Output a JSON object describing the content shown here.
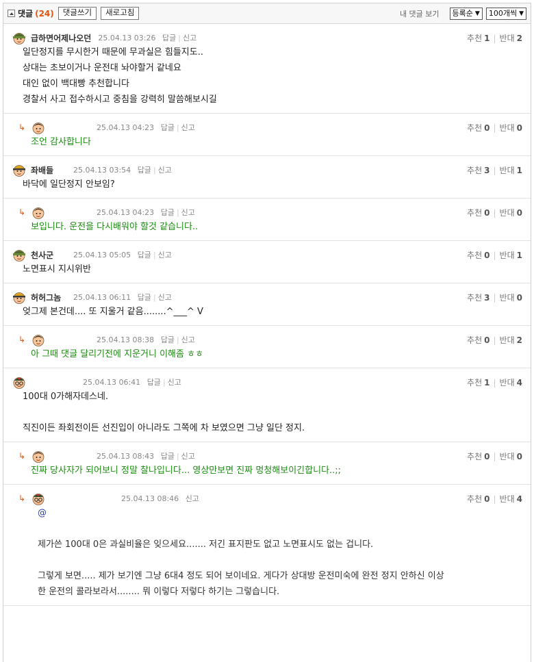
{
  "header": {
    "title": "댓글",
    "count": "(24)",
    "write_button": "댓글쓰기",
    "refresh_button": "새로고침",
    "my_comments": "내 댓글 보기",
    "sort_select": "등록순",
    "per_page_select": "100개씩"
  },
  "labels": {
    "reply": "답글",
    "report": "신고",
    "up": "추천",
    "down": "반대"
  },
  "colors": {
    "accent": "#e2540f",
    "reply_text": "#1e8c14",
    "mention": "#2a3aa0"
  },
  "comments": [
    {
      "type": "comment",
      "avatar": "green-helmet-avatar-icon",
      "nick": "급하면어제나오던",
      "date": "25.04.13 03:26",
      "up": "1",
      "down": "2",
      "lines": [
        "일단정지를 무시한거 때문에 무과실은 힘들지도..",
        "상대는 초보이거나 운전대 놔야할거 같네요",
        "대인 없이 백대빵 추천합니다",
        "경찰서 사고 접수하시고 중침을 강력히 말씀해보시길"
      ]
    },
    {
      "type": "reply",
      "avatar": "boy-avatar-icon",
      "nick": "",
      "date": "25.04.13 04:23",
      "up": "0",
      "down": "0",
      "lines": [
        "조언 감사합니다"
      ]
    },
    {
      "type": "comment",
      "avatar": "hardhat-avatar-icon",
      "nick": "좌배들",
      "date": "25.04.13 03:54",
      "up": "3",
      "down": "1",
      "lines": [
        "바닥에 일단정지 안보임?"
      ]
    },
    {
      "type": "reply",
      "avatar": "boy-avatar-icon",
      "nick": "",
      "date": "25.04.13 04:23",
      "up": "0",
      "down": "0",
      "lines": [
        "보입니다. 운전을 다시배워야 할것 같습니다.."
      ]
    },
    {
      "type": "comment",
      "avatar": "soldier-avatar-icon",
      "nick": "천사군",
      "date": "25.04.13 05:05",
      "up": "0",
      "down": "1",
      "lines": [
        "노면표시 지시위반"
      ]
    },
    {
      "type": "comment",
      "avatar": "hardhat-avatar-icon",
      "nick": "허허그놈",
      "date": "25.04.13 06:11",
      "up": "3",
      "down": "0",
      "lines": [
        "엊그제 본건데.... 또 지울거 같음........^___^ V"
      ]
    },
    {
      "type": "reply",
      "avatar": "boy-avatar-icon",
      "nick": "",
      "date": "25.04.13 08:38",
      "up": "0",
      "down": "2",
      "lines": [
        "아 그때 댓글 달리기전에 지운거니 이해좀 ㅎㅎ"
      ]
    },
    {
      "type": "comment",
      "avatar": "glasses-avatar-icon",
      "nick": "",
      "date": "25.04.13 06:41",
      "up": "1",
      "down": "4",
      "lines": [
        "100대 0가해자데스네.",
        "",
        "직진이든 좌회전이든 선진입이 아니라도 그쪽에 차 보였으면 그냥 일단 정지."
      ]
    },
    {
      "type": "reply",
      "avatar": "boy-avatar-icon",
      "nick": "",
      "date": "25.04.13 08:43",
      "up": "0",
      "down": "0",
      "lines": [
        "진짜 당사자가 되어보니 정말 찰나입니다... 영상만보면 진짜 멍청해보이긴합니다..;;"
      ]
    },
    {
      "type": "reply2",
      "avatar": "glasses-avatar-icon",
      "nick": "",
      "date": "25.04.13 08:46",
      "up": "0",
      "down": "4",
      "mention": "@",
      "lines": [
        "",
        "제가쓴 100대 0은 과실비율은 잊으세요....... 저긴 표지판도 없고 노면표시도 없는 겁니다.",
        "",
        "그렇게 보면..... 제가 보기엔 그냥 6대4 정도 되어 보이네요. 게다가 상대방 운전미숙에 완전 정지 안하신 이상",
        "한 운전의 콜라보라서........ 뭐 이렇다 저렇다 하기는 그렇습니다."
      ]
    }
  ]
}
